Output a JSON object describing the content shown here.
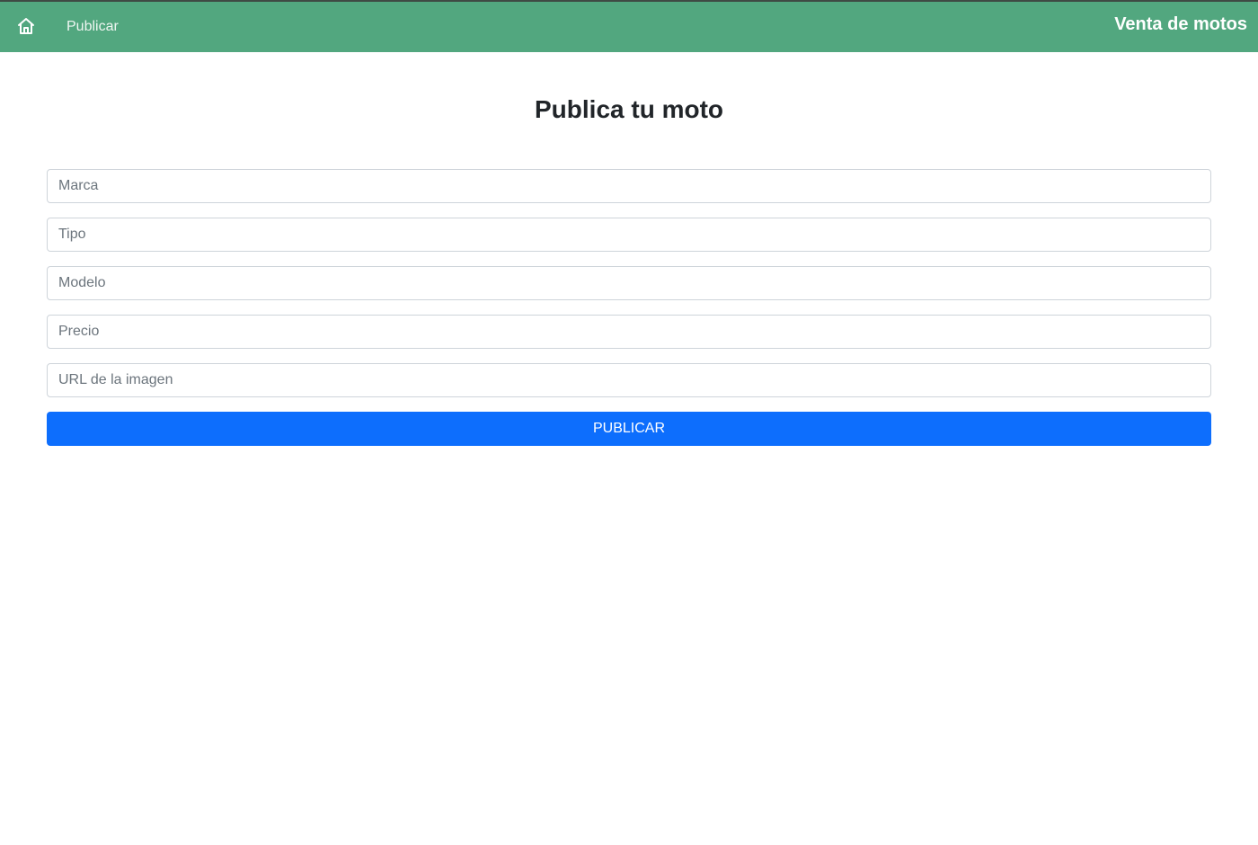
{
  "navbar": {
    "home_icon": "home-icon",
    "publish_link": "Publicar",
    "brand": "Venta de motos",
    "background_color": "#52a77f"
  },
  "main": {
    "title": "Publica tu moto",
    "fields": [
      {
        "placeholder": "Marca",
        "value": ""
      },
      {
        "placeholder": "Tipo",
        "value": ""
      },
      {
        "placeholder": "Modelo",
        "value": ""
      },
      {
        "placeholder": "Precio",
        "value": ""
      },
      {
        "placeholder": "URL de la imagen",
        "value": ""
      }
    ],
    "submit_label": "PUBLICAR",
    "submit_color": "#0d6efd"
  }
}
